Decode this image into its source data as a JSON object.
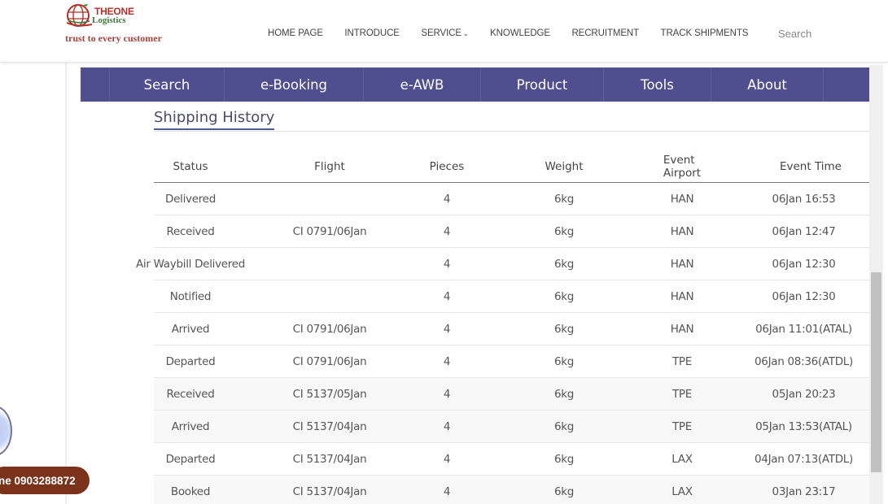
{
  "header": {
    "logo": {
      "brand_line1": "THEONE",
      "brand_line2": "Logistics",
      "tagline": "trust to every customer"
    },
    "nav": [
      {
        "label": "HOME PAGE"
      },
      {
        "label": "INTRODUCE"
      },
      {
        "label": "SERVICE",
        "has_dropdown": true,
        "dropdown_icon": "chevron-down-icon"
      },
      {
        "label": "KNOWLEDGE"
      },
      {
        "label": "RECRUITMENT"
      },
      {
        "label": "TRACK SHIPMENTS"
      }
    ],
    "search": {
      "placeholder": "Search",
      "value": ""
    }
  },
  "main_nav": {
    "items": [
      {
        "label": "Search"
      },
      {
        "label": "e-Booking"
      },
      {
        "label": "e-AWB"
      },
      {
        "label": "Product"
      },
      {
        "label": "Tools"
      },
      {
        "label": "About"
      }
    ]
  },
  "shipping_history": {
    "title": "Shipping History",
    "columns": [
      "Status",
      "Flight",
      "Pieces",
      "Weight",
      "Event Airport",
      "Event Time"
    ],
    "rows": [
      {
        "status": "Delivered",
        "flight": "",
        "pieces": "4",
        "weight": "6kg",
        "airport": "HAN",
        "time": "06Jan 16:53"
      },
      {
        "status": "Received",
        "flight": "CI 0791/06Jan",
        "pieces": "4",
        "weight": "6kg",
        "airport": "HAN",
        "time": "06Jan 12:47"
      },
      {
        "status": "Air Waybill Delivered",
        "flight": "",
        "pieces": "4",
        "weight": "6kg",
        "airport": "HAN",
        "time": "06Jan 12:30"
      },
      {
        "status": "Notified",
        "flight": "",
        "pieces": "4",
        "weight": "6kg",
        "airport": "HAN",
        "time": "06Jan 12:30"
      },
      {
        "status": "Arrived",
        "flight": "CI 0791/06Jan",
        "pieces": "4",
        "weight": "6kg",
        "airport": "HAN",
        "time": "06Jan 11:01(ATAL)"
      },
      {
        "status": "Departed",
        "flight": "CI 0791/06Jan",
        "pieces": "4",
        "weight": "6kg",
        "airport": "TPE",
        "time": "06Jan 08:36(ATDL)"
      },
      {
        "status": "Received",
        "flight": "CI 5137/05Jan",
        "pieces": "4",
        "weight": "6kg",
        "airport": "TPE",
        "time": "05Jan 20:23"
      },
      {
        "status": "Arrived",
        "flight": "CI 5137/04Jan",
        "pieces": "4",
        "weight": "6kg",
        "airport": "TPE",
        "time": "05Jan 13:53(ATAL)"
      },
      {
        "status": "Departed",
        "flight": "CI 5137/04Jan",
        "pieces": "4",
        "weight": "6kg",
        "airport": "LAX",
        "time": "04Jan 07:13(ATDL)"
      },
      {
        "status": "Booked",
        "flight": "CI 5137/04Jan",
        "pieces": "4",
        "weight": "6kg",
        "airport": "LAX",
        "time": "03Jan 23:17"
      }
    ]
  },
  "floating": {
    "hotline_text": "ne 0903288872",
    "call_icon": "phone-call-icon"
  },
  "colors": {
    "nav_bg": "#4f4f8f",
    "hotline_bg": "#7a321b",
    "logo_red": "#b3312a",
    "logo_green": "#3e7a3a"
  }
}
